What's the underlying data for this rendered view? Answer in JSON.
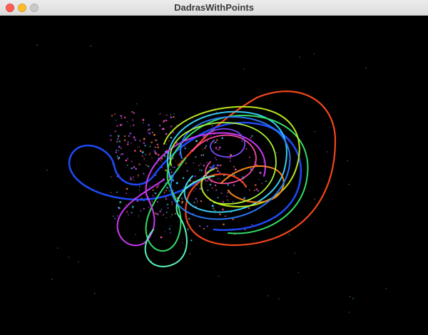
{
  "window": {
    "title": "DadrasWithPoints",
    "background": "#000000",
    "titlebar_buttons": [
      "close",
      "minimize",
      "zoom"
    ]
  },
  "scene": {
    "description_colors": {
      "orange_red": "#ff4a1c",
      "blue": "#1f4dff",
      "cyan": "#3ad7ff",
      "green": "#35e86a",
      "yellow_green": "#c6f01e",
      "magenta": "#d43cff",
      "pink": "#ff4fa8",
      "mint": "#5fffc0",
      "purple": "#7a4dff",
      "orange": "#ff8a1c",
      "point_particles": "#c04ad8"
    },
    "trajectory_colors": [
      "#ff4a1c",
      "#1f4dff",
      "#3ad7ff",
      "#35e86a",
      "#c6f01e",
      "#d43cff",
      "#ff4fa8",
      "#5fffc0",
      "#7a4dff",
      "#ff8a1c",
      "#2b7bff",
      "#b4ff3a"
    ]
  }
}
